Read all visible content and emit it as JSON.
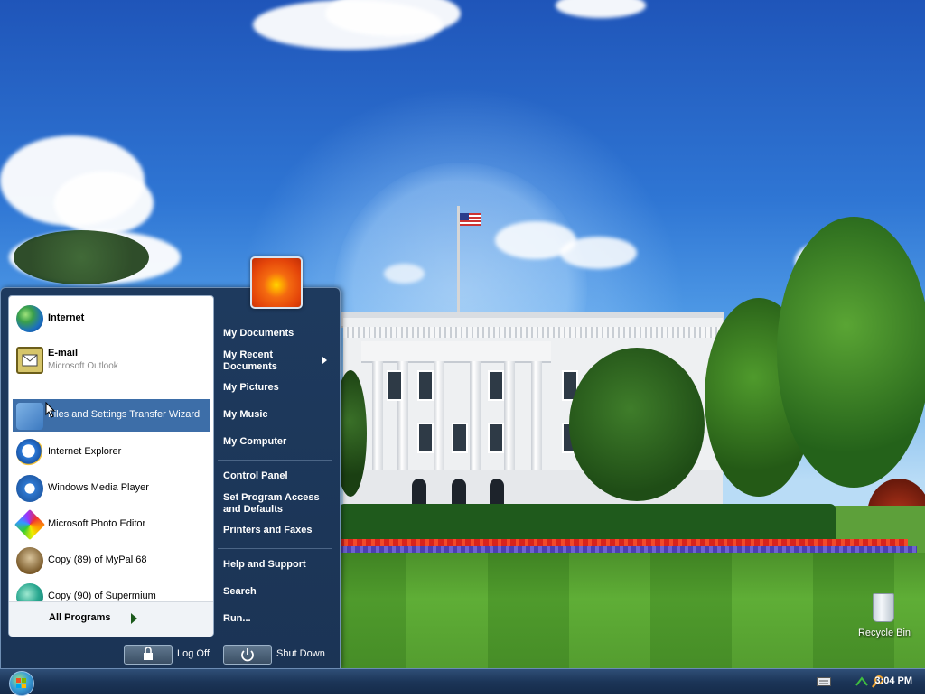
{
  "start_menu": {
    "pinned": [
      {
        "label": "Internet"
      },
      {
        "label": "E-mail",
        "sub": "Microsoft Outlook"
      }
    ],
    "recent": [
      {
        "label": "Files and Settings Transfer Wizard"
      },
      {
        "label": "Internet Explorer"
      },
      {
        "label": "Windows Media Player"
      },
      {
        "label": "Microsoft Photo Editor"
      },
      {
        "label": "Copy (89) of MyPal 68"
      },
      {
        "label": "Copy (90) of Supermium"
      }
    ],
    "all_programs": "All Programs",
    "places": {
      "my_documents": "My Documents",
      "my_recent_documents": "My Recent Documents",
      "my_pictures": "My Pictures",
      "my_music": "My Music",
      "my_computer": "My Computer",
      "control_panel": "Control Panel",
      "set_program_access": "Set Program Access and Defaults",
      "printers_faxes": "Printers and Faxes",
      "help_support": "Help and Support",
      "search": "Search",
      "run": "Run..."
    },
    "log_off": "Log Off",
    "shut_down": "Shut Down"
  },
  "desktop": {
    "recycle_bin": "Recycle Bin"
  },
  "taskbar": {
    "clock": "3:04 PM"
  },
  "colors": {
    "menu_bg": "#1e3a5e",
    "highlight": "#3d6ea8"
  }
}
